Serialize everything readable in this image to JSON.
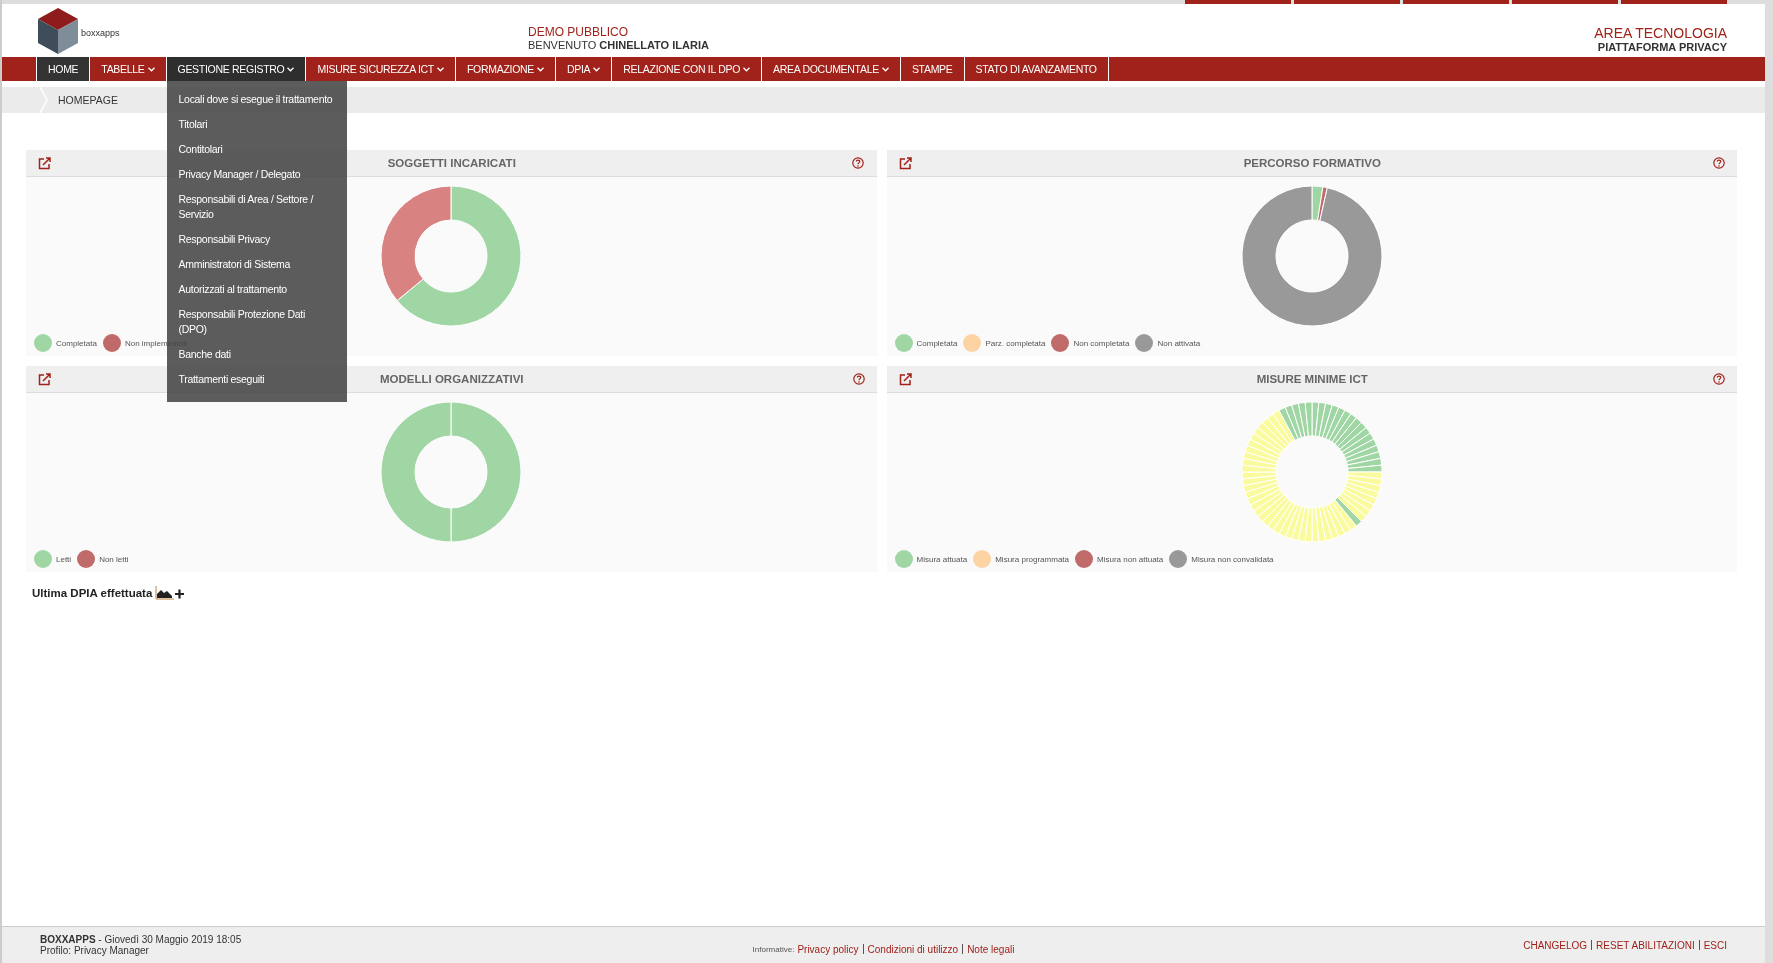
{
  "header": {
    "logo_text": "boxxapps",
    "center_title": "DEMO PUBBLICO",
    "welcome": "BENVENUTO **CHINELLATO ILARIA**",
    "area": "AREA TECNOLOGIA",
    "platform": "PIATTAFORMA PRIVACY"
  },
  "nav": [
    {
      "label": "HOME",
      "selected": true,
      "expanded": false,
      "has_menu": false
    },
    {
      "label": "TABELLE",
      "selected": false,
      "expanded": false,
      "has_menu": true
    },
    {
      "label": "GESTIONE REGISTRO",
      "selected": false,
      "expanded": true,
      "has_menu": true,
      "menu": [
        "Locali dove si esegue il trattamento",
        "Titolari",
        "Contitolari",
        "Privacy Manager / Delegato",
        "Responsabili di Area / Settore / Servizio",
        "Responsabili Privacy",
        "Amministratori di Sistema",
        "Autorizzati al trattamento",
        "Responsabili Protezione Dati (DPO)",
        "Banche dati",
        "Trattamenti eseguiti"
      ]
    },
    {
      "label": "MISURE SICUREZZA ICT",
      "selected": false,
      "expanded": false,
      "has_menu": true
    },
    {
      "label": "FORMAZIONE",
      "selected": false,
      "expanded": false,
      "has_menu": true
    },
    {
      "label": "DPIA",
      "selected": false,
      "expanded": false,
      "has_menu": true
    },
    {
      "label": "RELAZIONE CON IL DPO",
      "selected": false,
      "expanded": false,
      "has_menu": true
    },
    {
      "label": "AREA DOCUMENTALE",
      "selected": false,
      "expanded": false,
      "has_menu": true
    },
    {
      "label": "STAMPE",
      "selected": false,
      "expanded": false,
      "has_menu": false
    },
    {
      "label": "STATO DI AVANZAMENTO",
      "selected": false,
      "expanded": false,
      "has_menu": false
    }
  ],
  "breadcrumb": "HOMEPAGE",
  "panels": [
    {
      "title": "SOGGETTI INCARICATI",
      "legend": [
        {
          "label": "Completata",
          "color": "#a0d6a4"
        },
        {
          "label": "Non implementati",
          "color": "#c06a6a"
        }
      ]
    },
    {
      "title": "PERCORSO FORMATIVO",
      "legend": [
        {
          "label": "Completata",
          "color": "#a0d6a4"
        },
        {
          "label": "Parz. completata",
          "color": "#fdd3a4"
        },
        {
          "label": "Non completata",
          "color": "#c06a6a"
        },
        {
          "label": "Non attivata",
          "color": "#999999"
        }
      ]
    },
    {
      "title": "MODELLI ORGANIZZATIVI",
      "legend": [
        {
          "label": "Letti",
          "color": "#a0d6a4"
        },
        {
          "label": "Non letti",
          "color": "#c06a6a"
        }
      ]
    },
    {
      "title": "MISURE MINIME ICT",
      "legend": [
        {
          "label": "Misura attuata",
          "color": "#a0d6a4"
        },
        {
          "label": "Misura programmata",
          "color": "#fdd3a4"
        },
        {
          "label": "Misura non attuata",
          "color": "#c06a6a"
        },
        {
          "label": "Misura non convalidata",
          "color": "#999999"
        }
      ]
    }
  ],
  "last_dpia": "Ultima DPIA effettuata",
  "footer": {
    "brand": "**BOXXAPPS** - Giovedì 30 Maggio 2019 18:05",
    "profile": "Profilo: Privacy Manager",
    "info_label": "Informative:",
    "info_links": [
      "Privacy policy",
      "Condizioni di utilizzo",
      "Note legali"
    ],
    "right_links": [
      "CHANGELOG",
      "RESET ABILITAZIONI",
      "ESCI"
    ]
  }
}
